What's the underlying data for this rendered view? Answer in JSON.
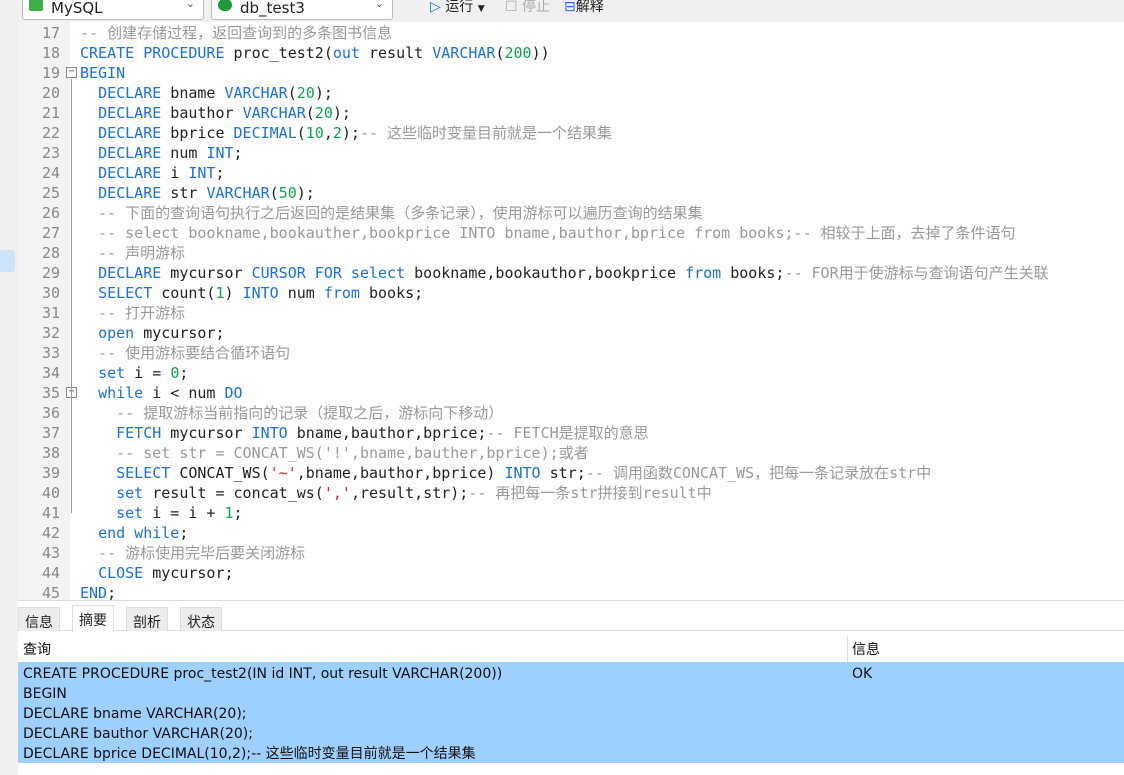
{
  "toolbar": {
    "connection": "MySQL",
    "database": "db_test3",
    "run": "运行",
    "stop": "停止",
    "explain": "解释"
  },
  "editor": {
    "fold_lines": [
      19,
      35
    ],
    "lines": [
      {
        "n": "17",
        "t": [
          [
            "c",
            "-- 创建存储过程，返回查询到的多条图书信息"
          ]
        ]
      },
      {
        "n": "18",
        "t": [
          [
            "k",
            "CREATE PROCEDURE"
          ],
          [
            "t",
            " proc_test2("
          ],
          [
            "k",
            "out"
          ],
          [
            "t",
            " result "
          ],
          [
            "k",
            "VARCHAR"
          ],
          [
            "t",
            "("
          ],
          [
            "n",
            "200"
          ],
          [
            "t",
            "))"
          ]
        ]
      },
      {
        "n": "19",
        "t": [
          [
            "k",
            "BEGIN"
          ]
        ]
      },
      {
        "n": "20",
        "t": [
          [
            "t",
            "  "
          ],
          [
            "k",
            "DECLARE"
          ],
          [
            "t",
            " bname "
          ],
          [
            "k",
            "VARCHAR"
          ],
          [
            "t",
            "("
          ],
          [
            "n",
            "20"
          ],
          [
            "t",
            ");"
          ]
        ]
      },
      {
        "n": "21",
        "t": [
          [
            "t",
            "  "
          ],
          [
            "k",
            "DECLARE"
          ],
          [
            "t",
            " bauthor "
          ],
          [
            "k",
            "VARCHAR"
          ],
          [
            "t",
            "("
          ],
          [
            "n",
            "20"
          ],
          [
            "t",
            ");"
          ]
        ]
      },
      {
        "n": "22",
        "t": [
          [
            "t",
            "  "
          ],
          [
            "k",
            "DECLARE"
          ],
          [
            "t",
            " bprice "
          ],
          [
            "k",
            "DECIMAL"
          ],
          [
            "t",
            "("
          ],
          [
            "n",
            "10"
          ],
          [
            "t",
            ","
          ],
          [
            "n",
            "2"
          ],
          [
            "t",
            ");"
          ],
          [
            "c",
            "-- 这些临时变量目前就是一个结果集"
          ]
        ]
      },
      {
        "n": "23",
        "t": [
          [
            "t",
            "  "
          ],
          [
            "k",
            "DECLARE"
          ],
          [
            "t",
            " num "
          ],
          [
            "k",
            "INT"
          ],
          [
            "t",
            ";"
          ]
        ]
      },
      {
        "n": "24",
        "t": [
          [
            "t",
            "  "
          ],
          [
            "k",
            "DECLARE"
          ],
          [
            "t",
            " i "
          ],
          [
            "k",
            "INT"
          ],
          [
            "t",
            ";"
          ]
        ]
      },
      {
        "n": "25",
        "t": [
          [
            "t",
            "  "
          ],
          [
            "k",
            "DECLARE"
          ],
          [
            "t",
            " str "
          ],
          [
            "k",
            "VARCHAR"
          ],
          [
            "t",
            "("
          ],
          [
            "n",
            "50"
          ],
          [
            "t",
            ");"
          ]
        ]
      },
      {
        "n": "26",
        "t": [
          [
            "t",
            "  "
          ],
          [
            "c",
            "-- 下面的查询语句执行之后返回的是结果集（多条记录），使用游标可以遍历查询的结果集"
          ]
        ]
      },
      {
        "n": "27",
        "t": [
          [
            "t",
            "  "
          ],
          [
            "c",
            "-- select bookname,bookauther,bookprice INTO bname,bauthor,bprice from books;-- 相较于上面，去掉了条件语句"
          ]
        ]
      },
      {
        "n": "28",
        "t": [
          [
            "t",
            "  "
          ],
          [
            "c",
            "-- 声明游标"
          ]
        ]
      },
      {
        "n": "29",
        "t": [
          [
            "t",
            "  "
          ],
          [
            "k",
            "DECLARE"
          ],
          [
            "t",
            " mycursor "
          ],
          [
            "k",
            "CURSOR FOR select"
          ],
          [
            "t",
            " bookname,bookauthor,bookprice "
          ],
          [
            "k",
            "from"
          ],
          [
            "t",
            " books;"
          ],
          [
            "c",
            "-- FOR用于使游标与查询语句产生关联"
          ]
        ]
      },
      {
        "n": "30",
        "t": [
          [
            "t",
            "  "
          ],
          [
            "k",
            "SELECT"
          ],
          [
            "t",
            " count("
          ],
          [
            "n",
            "1"
          ],
          [
            "t",
            ") "
          ],
          [
            "k",
            "INTO"
          ],
          [
            "t",
            " num "
          ],
          [
            "k",
            "from"
          ],
          [
            "t",
            " books;"
          ]
        ]
      },
      {
        "n": "31",
        "t": [
          [
            "t",
            "  "
          ],
          [
            "c",
            "-- 打开游标"
          ]
        ]
      },
      {
        "n": "32",
        "t": [
          [
            "t",
            "  "
          ],
          [
            "k",
            "open"
          ],
          [
            "t",
            " mycursor;"
          ]
        ]
      },
      {
        "n": "33",
        "t": [
          [
            "t",
            "  "
          ],
          [
            "c",
            "-- 使用游标要结合循环语句"
          ]
        ]
      },
      {
        "n": "34",
        "t": [
          [
            "t",
            "  "
          ],
          [
            "k",
            "set"
          ],
          [
            "t",
            " i = "
          ],
          [
            "n",
            "0"
          ],
          [
            "t",
            ";"
          ]
        ]
      },
      {
        "n": "35",
        "t": [
          [
            "t",
            "  "
          ],
          [
            "k",
            "while"
          ],
          [
            "t",
            " i < num "
          ],
          [
            "k",
            "DO"
          ]
        ]
      },
      {
        "n": "36",
        "t": [
          [
            "t",
            "    "
          ],
          [
            "c",
            "-- 提取游标当前指向的记录（提取之后，游标向下移动）"
          ]
        ]
      },
      {
        "n": "37",
        "t": [
          [
            "t",
            "    "
          ],
          [
            "k",
            "FETCH"
          ],
          [
            "t",
            " mycursor "
          ],
          [
            "k",
            "INTO"
          ],
          [
            "t",
            " bname,bauthor,bprice;"
          ],
          [
            "c",
            "-- FETCH是提取的意思"
          ]
        ]
      },
      {
        "n": "38",
        "t": [
          [
            "t",
            "    "
          ],
          [
            "c",
            "-- set str = CONCAT_WS('!',bname,bauther,bprice);或者"
          ]
        ]
      },
      {
        "n": "39",
        "t": [
          [
            "t",
            "    "
          ],
          [
            "k",
            "SELECT"
          ],
          [
            "t",
            " CONCAT_WS("
          ],
          [
            "s",
            "'~'"
          ],
          [
            "t",
            ",bname,bauthor,bprice) "
          ],
          [
            "k",
            "INTO"
          ],
          [
            "t",
            " str;"
          ],
          [
            "c",
            "-- 调用函数CONCAT_WS，把每一条记录放在str中"
          ]
        ]
      },
      {
        "n": "40",
        "t": [
          [
            "t",
            "    "
          ],
          [
            "k",
            "set"
          ],
          [
            "t",
            " result = concat_ws("
          ],
          [
            "s",
            "','"
          ],
          [
            "t",
            ",result,str);"
          ],
          [
            "c",
            "-- 再把每一条str拼接到result中"
          ]
        ]
      },
      {
        "n": "41",
        "t": [
          [
            "t",
            "    "
          ],
          [
            "k",
            "set"
          ],
          [
            "t",
            " i = i + "
          ],
          [
            "n",
            "1"
          ],
          [
            "t",
            ";"
          ]
        ]
      },
      {
        "n": "42",
        "t": [
          [
            "t",
            "  "
          ],
          [
            "k",
            "end while"
          ],
          [
            "t",
            ";"
          ]
        ]
      },
      {
        "n": "43",
        "t": [
          [
            "t",
            "  "
          ],
          [
            "c",
            "-- 游标使用完毕后要关闭游标"
          ]
        ]
      },
      {
        "n": "44",
        "t": [
          [
            "t",
            "  "
          ],
          [
            "k",
            "CLOSE"
          ],
          [
            "t",
            " mycursor;"
          ]
        ]
      },
      {
        "n": "45",
        "t": [
          [
            "k",
            "END"
          ],
          [
            "t",
            ";"
          ]
        ]
      }
    ]
  },
  "result_panel": {
    "tabs": [
      "信息",
      "摘要",
      "剖析",
      "状态"
    ],
    "active_tab": "摘要",
    "columns": [
      "查询",
      "信息"
    ],
    "query_lines": [
      "CREATE PROCEDURE proc_test2(IN id INT, out result VARCHAR(200))",
      "BEGIN",
      "DECLARE bname VARCHAR(20);",
      "DECLARE bauthor VARCHAR(20);",
      "DECLARE bprice DECIMAL(10,2);-- 这些临时变量目前就是一个结果集"
    ],
    "info": "OK",
    "selected_color": "#9dcfff"
  }
}
